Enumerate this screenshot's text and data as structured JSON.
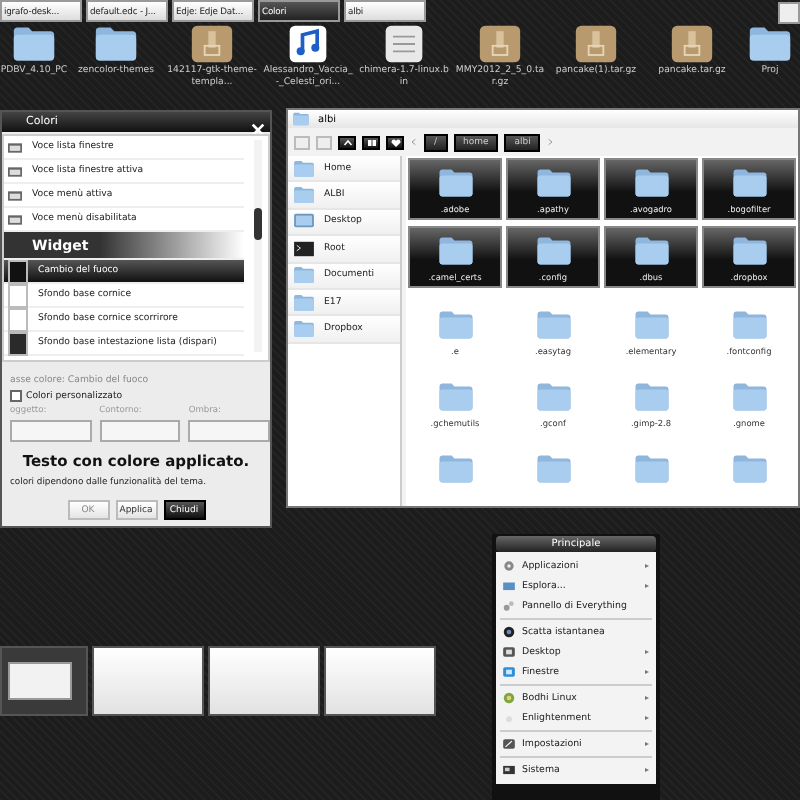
{
  "taskbar": {
    "tasks": [
      {
        "label": "igrafo-desk...",
        "selected": false
      },
      {
        "label": "default.edc - J...",
        "selected": false
      },
      {
        "label": "Edje: Edje Dat...",
        "selected": false
      },
      {
        "label": "Colori",
        "selected": true
      },
      {
        "label": "albi",
        "selected": false
      }
    ]
  },
  "desktop_icons": [
    {
      "label": "PDBV_4.10_PC",
      "kind": "folder"
    },
    {
      "label": "zencolor-themes",
      "kind": "folder"
    },
    {
      "label": "142117-gtk-theme-templa...",
      "kind": "archive"
    },
    {
      "label": "Alessandro_Vaccia_-_Celesti_ori...",
      "kind": "audio"
    },
    {
      "label": "chimera-1.7-linux.bin",
      "kind": "document"
    },
    {
      "label": "MMY2012_2_5_0.tar.gz",
      "kind": "archive"
    },
    {
      "label": "pancake(1).tar.gz",
      "kind": "archive"
    },
    {
      "label": "pancake.tar.gz",
      "kind": "archive"
    },
    {
      "label": "Proj",
      "kind": "folder"
    }
  ],
  "colors_dialog": {
    "title": "Colori",
    "rows": [
      {
        "label": "Voce lista finestre",
        "kind": "entry",
        "selected": false
      },
      {
        "label": "Voce lista finestre attiva",
        "kind": "entry",
        "selected": false
      },
      {
        "label": "Voce menù attiva",
        "kind": "entry",
        "selected": false
      },
      {
        "label": "Voce menù disabilitata",
        "kind": "entry",
        "selected": false
      },
      {
        "label": "Widget",
        "kind": "header",
        "selected": false
      },
      {
        "label": "Cambio del fuoco",
        "kind": "swatch",
        "color": "#111111",
        "selected": true
      },
      {
        "label": "Sfondo base cornice",
        "kind": "swatch",
        "color": "#ffffff",
        "selected": false
      },
      {
        "label": "Sfondo base cornice scorrirore",
        "kind": "swatch",
        "color": "#ffffff",
        "selected": false
      },
      {
        "label": "Sfondo base intestazione lista (dispari)",
        "kind": "swatch",
        "color": "#2a2a2a",
        "selected": false
      }
    ],
    "class_label": "asse colore: Cambio del fuoco",
    "custom": {
      "label": "Colori personalizzato",
      "checked": false
    },
    "fields": [
      "oggetto:",
      "Contorno:",
      "Ombra:"
    ],
    "preview": "Testo con colore applicato.",
    "note": "colori dipendono dalle funzionalità del tema.",
    "buttons": [
      {
        "label": "OK",
        "kind": "normal",
        "disabled": true
      },
      {
        "label": "Applica",
        "kind": "normal",
        "disabled": false
      },
      {
        "label": "Chiudi",
        "kind": "dark",
        "disabled": false
      }
    ]
  },
  "file_manager": {
    "title": "albi",
    "path": [
      "/",
      "home",
      "albi"
    ],
    "places": [
      {
        "label": "Home",
        "kind": "folder"
      },
      {
        "label": "ALBI",
        "kind": "folder"
      },
      {
        "label": "Desktop",
        "kind": "desktop"
      },
      {
        "label": "Root",
        "kind": "root"
      },
      {
        "label": "Documenti",
        "kind": "folder"
      },
      {
        "label": "E17",
        "kind": "folder"
      },
      {
        "label": "Dropbox",
        "kind": "folder"
      }
    ],
    "files": [
      {
        "label": ".adobe",
        "selected": true
      },
      {
        "label": ".apathy",
        "selected": true
      },
      {
        "label": ".avogadro",
        "selected": true
      },
      {
        "label": ".bogofilter",
        "selected": true
      },
      {
        "label": ".camel_certs",
        "selected": true
      },
      {
        "label": ".config",
        "selected": true
      },
      {
        "label": ".dbus",
        "selected": true
      },
      {
        "label": ".dropbox",
        "selected": true
      },
      {
        "label": ".e",
        "selected": false
      },
      {
        "label": ".easytag",
        "selected": false
      },
      {
        "label": ".elementary",
        "selected": false
      },
      {
        "label": ".fontconfig",
        "selected": false
      },
      {
        "label": ".gchemutils",
        "selected": false
      },
      {
        "label": ".gconf",
        "selected": false
      },
      {
        "label": ".gimp-2.8",
        "selected": false
      },
      {
        "label": ".gnome",
        "selected": false
      },
      {
        "selected": false
      },
      {
        "selected": false
      },
      {
        "selected": false
      },
      {
        "selected": false
      }
    ]
  },
  "menu": {
    "title": "Principale",
    "items": [
      {
        "label": "Applicazioni",
        "kind": "item",
        "submenu": true
      },
      {
        "label": "Esplora...",
        "kind": "item",
        "submenu": true
      },
      {
        "label": "Pannello di Everything",
        "kind": "item",
        "submenu": false
      },
      {
        "kind": "separator"
      },
      {
        "label": "Scatta istantanea",
        "kind": "item",
        "submenu": false
      },
      {
        "label": "Desktop",
        "kind": "item",
        "submenu": true
      },
      {
        "label": "Finestre",
        "kind": "item",
        "submenu": true
      },
      {
        "kind": "separator"
      },
      {
        "label": "Bodhi Linux",
        "kind": "item",
        "submenu": true
      },
      {
        "label": "Enlightenment",
        "kind": "item",
        "submenu": true
      },
      {
        "kind": "separator"
      },
      {
        "label": "Impostazioni",
        "kind": "item",
        "submenu": true
      },
      {
        "kind": "separator"
      },
      {
        "label": "Sistema",
        "kind": "item",
        "submenu": true
      }
    ]
  },
  "pager": {
    "desktops": [
      {
        "selected": true
      },
      {
        "selected": false
      },
      {
        "selected": false
      },
      {
        "selected": false
      }
    ]
  }
}
